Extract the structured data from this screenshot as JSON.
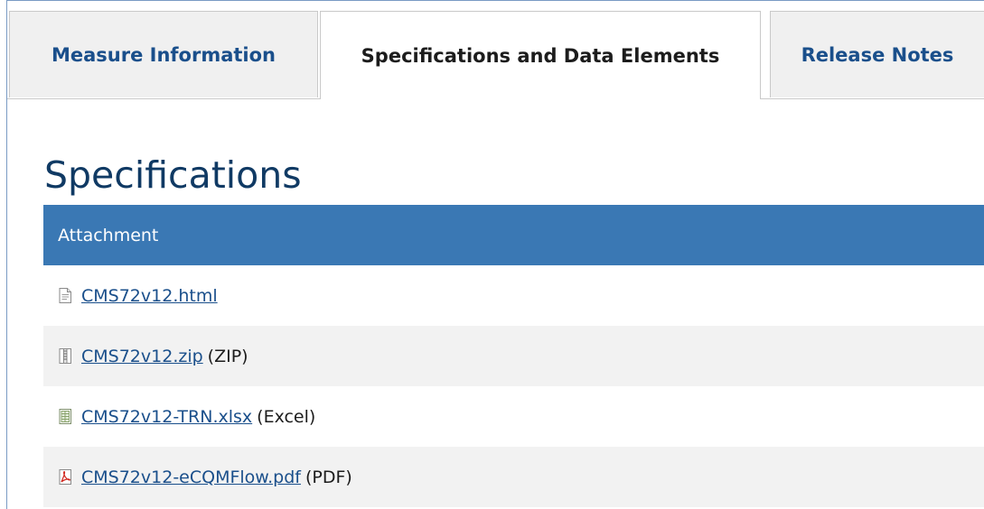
{
  "tabs": [
    {
      "label": "Measure Information",
      "active": false
    },
    {
      "label": "Specifications and Data Elements",
      "active": true
    },
    {
      "label": "Release Notes",
      "active": false
    }
  ],
  "section_title": "Specifications",
  "table": {
    "header": "Attachment",
    "rows": [
      {
        "file": "CMS72v12.html",
        "suffix": "",
        "icon": "html-file-icon"
      },
      {
        "file": "CMS72v12.zip",
        "suffix": "(ZIP)",
        "icon": "zip-file-icon"
      },
      {
        "file": "CMS72v12-TRN.xlsx",
        "suffix": "(Excel)",
        "icon": "excel-file-icon"
      },
      {
        "file": "CMS72v12-eCQMFlow.pdf",
        "suffix": "(PDF)",
        "icon": "pdf-file-icon"
      }
    ]
  },
  "colors": {
    "tab_link": "#1a4f8b",
    "header_bg": "#3a78b4",
    "title": "#103a64",
    "stripe": "#f2f2f2"
  }
}
